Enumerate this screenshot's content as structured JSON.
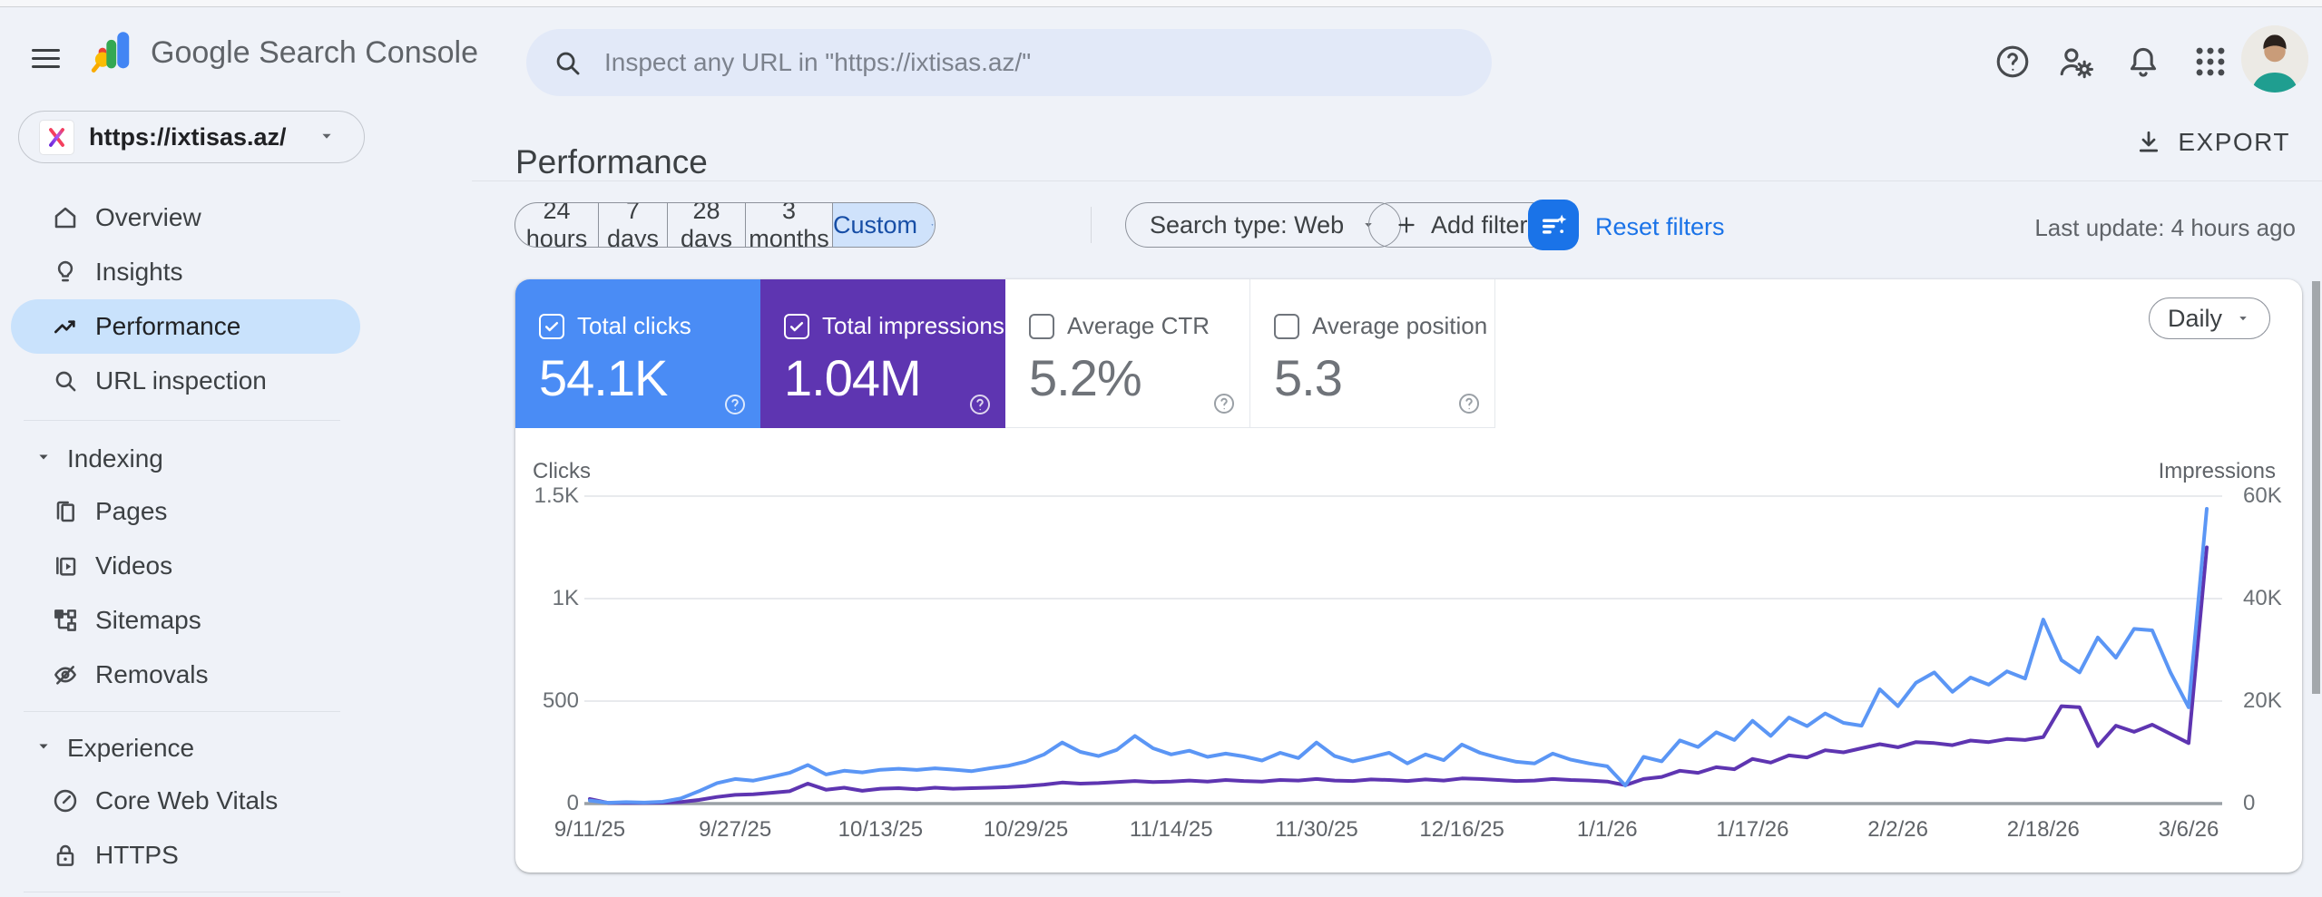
{
  "topbar": {
    "product_name": "Google Search Console",
    "search_placeholder": "Inspect any URL in \"https://ixtisas.az/\""
  },
  "property": {
    "url": "https://ixtisas.az/"
  },
  "sidebar": {
    "items": [
      {
        "label": "Overview",
        "active": false
      },
      {
        "label": "Insights",
        "active": false
      },
      {
        "label": "Performance",
        "active": true
      },
      {
        "label": "URL inspection",
        "active": false
      }
    ],
    "sections": [
      {
        "label": "Indexing",
        "items": [
          {
            "label": "Pages"
          },
          {
            "label": "Videos"
          },
          {
            "label": "Sitemaps"
          },
          {
            "label": "Removals"
          }
        ]
      },
      {
        "label": "Experience",
        "items": [
          {
            "label": "Core Web Vitals"
          },
          {
            "label": "HTTPS"
          }
        ]
      }
    ]
  },
  "page": {
    "title": "Performance",
    "export_label": "EXPORT",
    "last_update": "Last update: 4 hours ago"
  },
  "filters": {
    "date_ranges": [
      "24 hours",
      "7 days",
      "28 days",
      "3 months",
      "Custom"
    ],
    "selected_range": "Custom",
    "search_type": "Search type: Web",
    "add_filter_label": "Add filter",
    "reset_label": "Reset filters"
  },
  "metrics": [
    {
      "label": "Total clicks",
      "value": "54.1K",
      "checked": true,
      "color": "#4a8cf5"
    },
    {
      "label": "Total impressions",
      "value": "1.04M",
      "checked": true,
      "color": "#5e35b1"
    },
    {
      "label": "Average CTR",
      "value": "5.2%",
      "checked": false,
      "color": "#ffffff"
    },
    {
      "label": "Average position",
      "value": "5.3",
      "checked": false,
      "color": "#ffffff"
    }
  ],
  "chart_controls": {
    "granularity": "Daily"
  },
  "colors": {
    "accent_blue": "#1a73e8",
    "clicks_blue": "#4a8cf5",
    "impressions_purple": "#5e35b1",
    "chart_line_blue": "#5b96f5",
    "active_nav_bg": "#c9e2fc"
  },
  "chart_data": {
    "type": "line",
    "title": "Clicks and Impressions over time (Daily)",
    "ylabel_left": "Clicks",
    "ylabel_right": "Impressions",
    "y_left_ticks": [
      "1.5K",
      "1K",
      "500",
      "0"
    ],
    "y_right_ticks": [
      "60K",
      "40K",
      "20K",
      "0"
    ],
    "y_left_max": 1500,
    "y_right_max": 60000,
    "grid": true,
    "legend": "none",
    "x_tick_labels": [
      "9/11/25",
      "9/27/25",
      "10/13/25",
      "10/29/25",
      "11/14/25",
      "11/30/25",
      "12/16/25",
      "1/1/26",
      "1/17/26",
      "2/2/26",
      "2/18/26",
      "3/6/26"
    ],
    "x_tick_indices": [
      0,
      8,
      16,
      24,
      32,
      40,
      48,
      56,
      64,
      72,
      80,
      88
    ],
    "series": [
      {
        "name": "Clicks",
        "axis": "left",
        "color": "#5b96f5",
        "values": [
          15,
          4,
          7,
          5,
          9,
          25,
          60,
          100,
          120,
          112,
          130,
          150,
          188,
          142,
          160,
          152,
          165,
          170,
          164,
          172,
          166,
          158,
          172,
          184,
          205,
          240,
          298,
          252,
          232,
          262,
          330,
          270,
          240,
          258,
          228,
          244,
          230,
          210,
          248,
          222,
          298,
          232,
          206,
          226,
          248,
          196,
          240,
          212,
          288,
          248,
          224,
          204,
          196,
          244,
          214,
          196,
          182,
          88,
          228,
          206,
          308,
          276,
          348,
          310,
          404,
          330,
          420,
          378,
          440,
          394,
          380,
          558,
          475,
          590,
          640,
          545,
          615,
          580,
          645,
          610,
          898,
          700,
          640,
          810,
          712,
          852,
          845,
          640,
          470,
          1438
        ]
      },
      {
        "name": "Impressions",
        "axis": "right",
        "color": "#5e35b1",
        "values": [
          900,
          150,
          120,
          140,
          180,
          300,
          700,
          1300,
          1700,
          1800,
          2100,
          2400,
          3900,
          2700,
          3100,
          2500,
          2900,
          3000,
          2800,
          3100,
          2900,
          3000,
          3100,
          3200,
          3400,
          3700,
          4100,
          3900,
          4000,
          4200,
          4400,
          4200,
          4300,
          4500,
          4300,
          4600,
          4400,
          4300,
          4600,
          4500,
          4800,
          4500,
          4400,
          4700,
          4600,
          4400,
          4700,
          4500,
          4900,
          4800,
          4600,
          4400,
          4500,
          4800,
          4600,
          4500,
          4300,
          3600,
          4800,
          5200,
          6400,
          6000,
          7100,
          6700,
          8700,
          8000,
          9400,
          9000,
          10400,
          10000,
          10800,
          11600,
          11000,
          12000,
          11800,
          11400,
          12300,
          12000,
          12600,
          12400,
          13000,
          19000,
          18800,
          11200,
          15200,
          14000,
          15400,
          13600,
          11800,
          50000
        ]
      }
    ]
  }
}
